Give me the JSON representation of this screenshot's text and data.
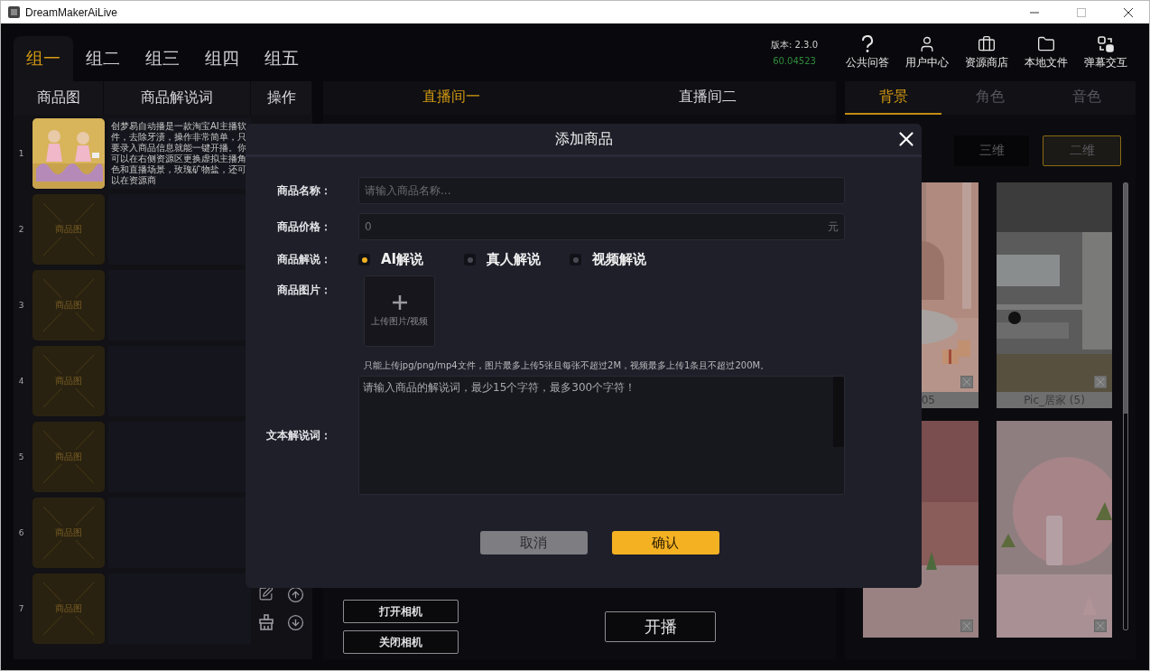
{
  "window": {
    "title": "DreamMakerAiLive"
  },
  "groups": [
    {
      "label": "组一",
      "selected": true
    },
    {
      "label": "组二",
      "selected": false
    },
    {
      "label": "组三",
      "selected": false
    },
    {
      "label": "组四",
      "selected": false
    },
    {
      "label": "组五",
      "selected": false
    }
  ],
  "version": {
    "label": "版本: 2.3.0",
    "build": "60.04523"
  },
  "toolbar": [
    {
      "kind": "help",
      "label": "公共问答"
    },
    {
      "kind": "user",
      "label": "用户中心"
    },
    {
      "kind": "store",
      "label": "资源商店"
    },
    {
      "kind": "folder",
      "label": "本地文件"
    },
    {
      "kind": "danmaku",
      "label": "弹幕交互"
    }
  ],
  "product_table": {
    "columns": [
      "商品图",
      "商品解说词",
      "操作"
    ],
    "rows": [
      {
        "number": "1",
        "image": {
          "kind": "picture"
        },
        "description": "创梦易自动播是一款淘宝AI主播软件，去除牙渍，操作非常简单，只要录入商品信息就能一键开播。你可以在右侧资源区更换虚拟主播角色和直播场景，玫瑰矿物盐，还可以在资源商"
      },
      {
        "number": "2",
        "image_placeholder": "商品图"
      },
      {
        "number": "3",
        "image_placeholder": "商品图"
      },
      {
        "number": "4",
        "image_placeholder": "商品图"
      },
      {
        "number": "5",
        "image_placeholder": "商品图"
      },
      {
        "number": "6",
        "image_placeholder": "商品图"
      },
      {
        "number": "7",
        "image_placeholder": "商品图"
      }
    ]
  },
  "rooms": {
    "tabs": [
      {
        "label": "直播间一",
        "selected": true
      },
      {
        "label": "直播间二",
        "selected": false
      }
    ],
    "camera_buttons": [
      "打开相机",
      "关闭相机"
    ],
    "start_button": "开播"
  },
  "resources": {
    "tabs": [
      {
        "label": "背景",
        "selected": true
      },
      {
        "label": "角色",
        "selected": false
      },
      {
        "label": "音色",
        "selected": false
      }
    ],
    "modes": [
      {
        "label": "三维",
        "selected": false
      },
      {
        "label": "二维",
        "selected": true
      }
    ],
    "items": [
      {
        "kind": "picture",
        "label": "05"
      },
      {
        "kind": "picture",
        "label": "Pic_居家 (5)"
      },
      {
        "kind": "picture"
      },
      {
        "kind": "picture"
      }
    ]
  },
  "dialog": {
    "title": "添加商品",
    "name": {
      "label": "商品名称：",
      "placeholder": "请输入商品名称..."
    },
    "price": {
      "label": "商品价格：",
      "placeholder": "0",
      "unit": "元"
    },
    "narration": {
      "label": "商品解说：",
      "options": [
        {
          "label": "AI解说",
          "selected": true
        },
        {
          "label": "真人解说",
          "selected": false
        },
        {
          "label": "视频解说",
          "selected": false
        }
      ]
    },
    "image": {
      "label": "商品图片：",
      "upload": "上传图片/视频",
      "hint": "只能上传jpg/png/mp4文件，图片最多上传5张且每张不超过2M，视频最多上传1条且不超过200M。"
    },
    "script": {
      "label": "文本解说词：",
      "placeholder": "请输入商品的解说词，最少15个字符，最多300个字符！"
    },
    "buttons": [
      {
        "kind": "cancel",
        "label": "取消"
      },
      {
        "kind": "confirm",
        "label": "确认"
      }
    ]
  }
}
